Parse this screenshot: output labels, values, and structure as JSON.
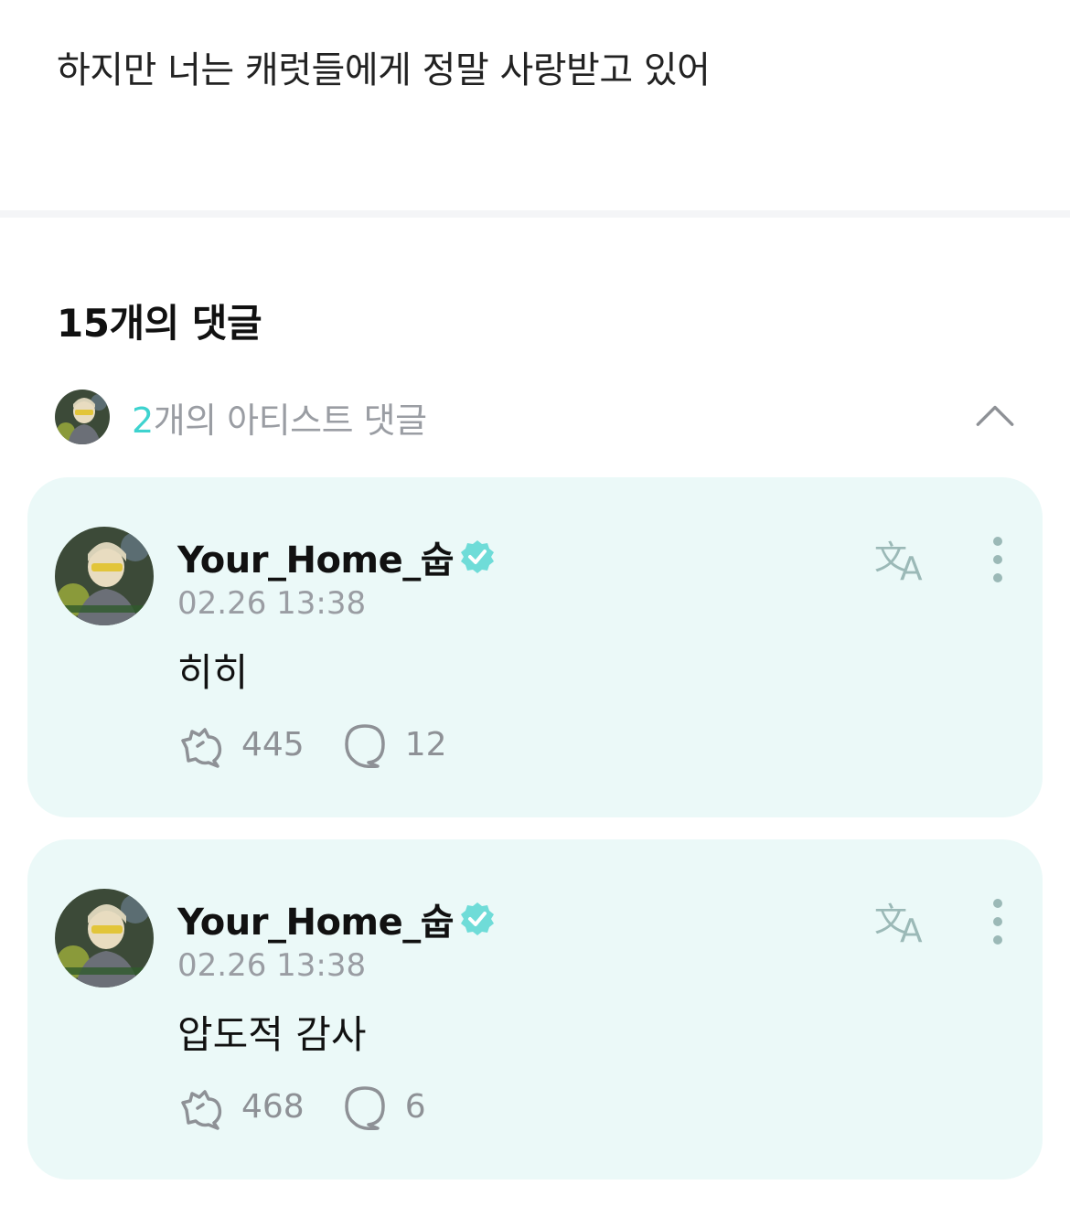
{
  "post": {
    "text": "하지만 너는 캐럿들에게 정말 사랑받고 있어"
  },
  "comments_section": {
    "title": "15개의 댓글",
    "artist_comments": {
      "count": "2",
      "label": "개의 아티스트 댓글",
      "collapse_icon": "chevron-up-icon"
    }
  },
  "comments": [
    {
      "username": "Your_Home_숩",
      "verified_icon": "verified-badge-icon",
      "timestamp": "02.26 13:38",
      "text": "히히",
      "likes": "445",
      "replies": "12",
      "translate_icon": "translate-icon",
      "more_icon": "more-vertical-icon"
    },
    {
      "username": "Your_Home_숩",
      "verified_icon": "verified-badge-icon",
      "timestamp": "02.26 13:38",
      "text": "압도적 감사",
      "likes": "468",
      "replies": "6",
      "translate_icon": "translate-icon",
      "more_icon": "more-vertical-icon"
    }
  ],
  "colors": {
    "accent": "#3ed3cf",
    "card_bg": "#ebf9f8",
    "muted_text": "#9a9da3"
  }
}
